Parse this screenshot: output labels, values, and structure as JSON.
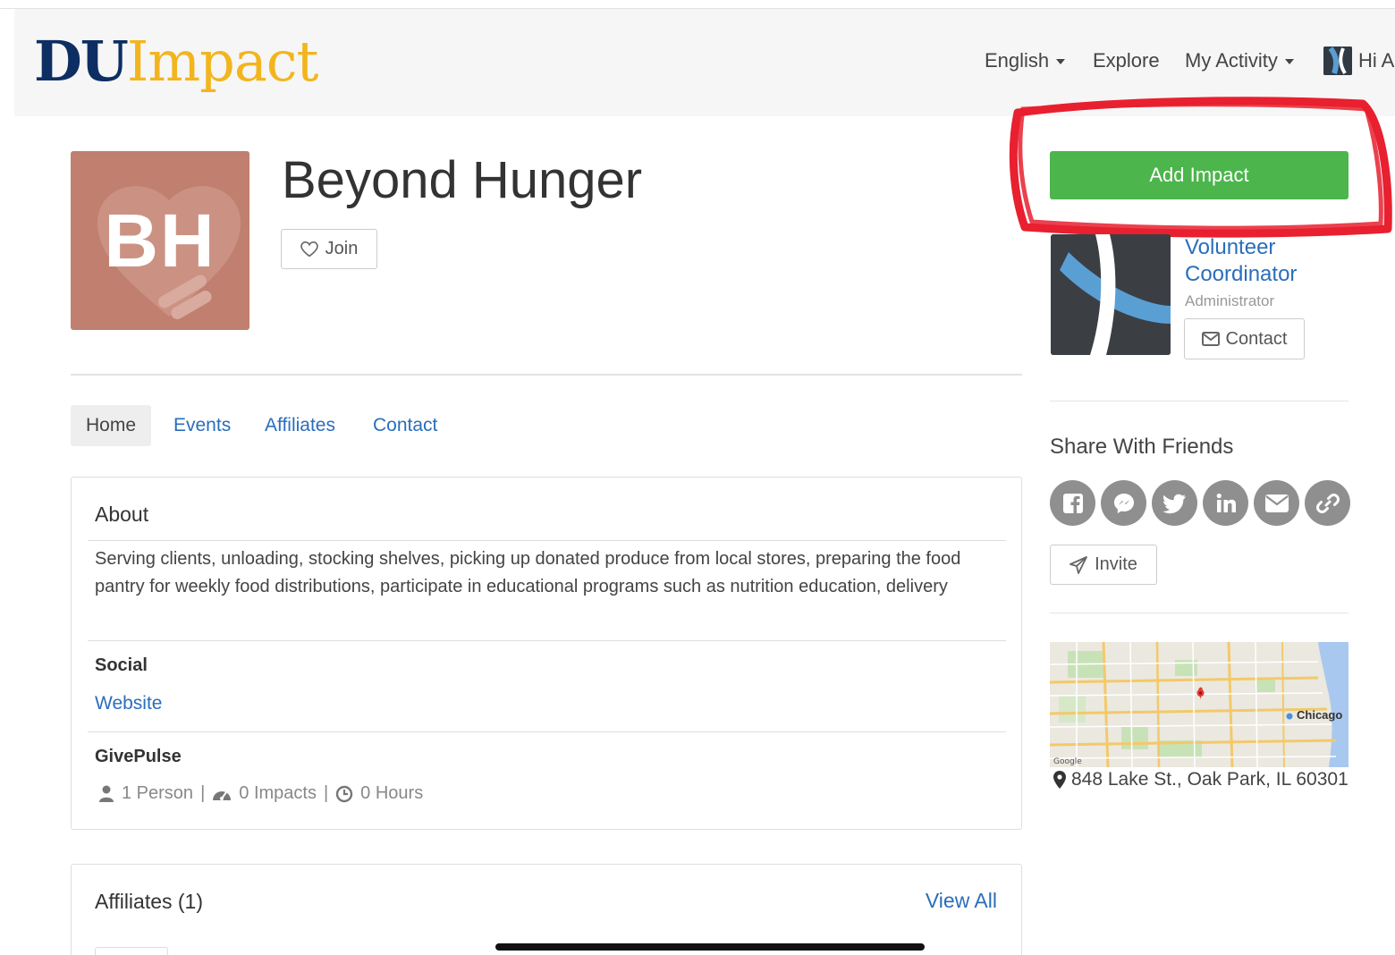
{
  "brand": {
    "part1": "DU",
    "part2": "Impact"
  },
  "nav": {
    "language": "English",
    "explore": "Explore",
    "my_activity": "My Activity",
    "greeting": "Hi A"
  },
  "org": {
    "initials": "BH",
    "name": "Beyond Hunger",
    "join_label": "Join"
  },
  "tabs": [
    "Home",
    "Events",
    "Affiliates",
    "Contact"
  ],
  "about": {
    "title": "About",
    "text": "Serving clients, unloading, stocking shelves, picking up donated produce from local stores, preparing the food pantry for weekly food distributions, participate in educational programs such as nutrition education, delivery",
    "social_label": "Social",
    "website_label": "Website",
    "givepulse_label": "GivePulse",
    "stats": {
      "persons": "1 Person",
      "impacts": "0 Impacts",
      "hours": "0 Hours"
    }
  },
  "affiliates": {
    "title": "Affiliates (1)",
    "view_all": "View All"
  },
  "sidebar": {
    "add_impact": "Add Impact",
    "coordinator_name": "Volunteer Coordinator",
    "coordinator_role": "Administrator",
    "contact_label": "Contact",
    "share_title": "Share With Friends",
    "share_icons": [
      "facebook-icon",
      "messenger-icon",
      "twitter-icon",
      "linkedin-icon",
      "email-icon",
      "link-icon"
    ],
    "invite_label": "Invite",
    "map_city_label": "Chicago",
    "address": "848 Lake St., Oak Park, IL 60301"
  },
  "colors": {
    "brand_navy": "#0d2e63",
    "brand_gold": "#f2b51d",
    "link_blue": "#2a6ebb",
    "add_green": "#4cb54c",
    "annotation_red": "#e8202f",
    "org_logo": "#c07f6f"
  }
}
